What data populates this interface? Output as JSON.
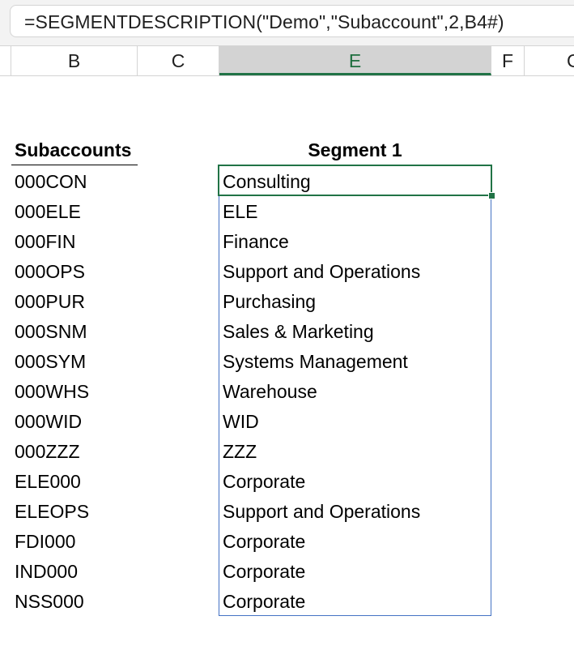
{
  "formula_bar": {
    "formula": "=SEGMENTDESCRIPTION(\"Demo\",\"Subaccount\",2,B4#)"
  },
  "column_headers": [
    "B",
    "C",
    "E",
    "F",
    "G"
  ],
  "selected_column": "E",
  "sheet": {
    "subaccounts_header": "Subaccounts",
    "segment_header": "Segment 1",
    "subaccounts": [
      "000CON",
      "000ELE",
      "000FIN",
      "000OPS",
      "000PUR",
      "000SNM",
      "000SYM",
      "000WHS",
      "000WID",
      "000ZZZ",
      "ELE000",
      "ELEOPS",
      "FDI000",
      "IND000",
      "NSS000"
    ],
    "segment_descriptions": [
      "Consulting",
      "ELE",
      "Finance",
      "Support and Operations",
      "Purchasing",
      "Sales & Marketing",
      "Systems Management",
      "Warehouse",
      "WID",
      "ZZZ",
      "Corporate",
      "Support and Operations",
      "Corporate",
      "Corporate",
      "Corporate"
    ]
  },
  "colors": {
    "selection_green": "#217346",
    "spill_border_blue": "#4472c4"
  }
}
